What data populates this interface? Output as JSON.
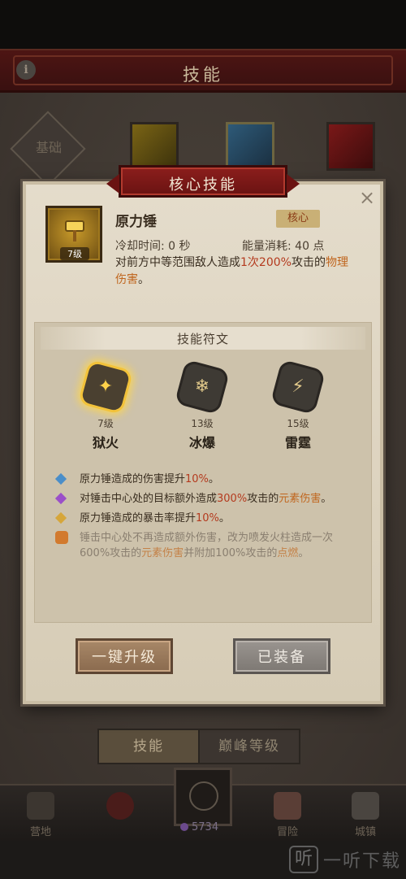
{
  "window": {
    "title": "技能"
  },
  "background": {
    "base_tab": "基础",
    "tabs": [
      {
        "label": "技能"
      },
      {
        "label": "巅峰等级"
      }
    ],
    "nav": [
      {
        "label": "营地"
      },
      {
        "label": ""
      },
      {
        "label": "冒险"
      },
      {
        "label": "城镇"
      }
    ],
    "currency": "5734"
  },
  "dialog": {
    "header": "核心技能",
    "close": "×",
    "skill": {
      "name": "原力锤",
      "level_tag": "7级",
      "badge": "核心",
      "cooldown": "冷却时间: 0 秒",
      "energy": "能量消耗: 40 点",
      "desc_prefix": "对前方中等范围敌人造成",
      "desc_count": "1次",
      "desc_percent": "200%",
      "desc_mid": "攻击的",
      "desc_type": "物理伤害",
      "desc_end": "。"
    },
    "runes": {
      "title": "技能符文",
      "items": [
        {
          "level": "7级",
          "name": "狱火"
        },
        {
          "level": "13级",
          "name": "冰爆"
        },
        {
          "level": "15级",
          "name": "雷霆"
        }
      ]
    },
    "effects": [
      {
        "a": "原力锤造成的伤害提升",
        "b": "10%",
        "c": "。",
        "color": "#4a8ec9"
      },
      {
        "a": "对锤击中心处的目标额外造成",
        "b": "300%",
        "c": "攻击的",
        "d": "元素伤害",
        "e": "。",
        "color": "#9b4fc9"
      },
      {
        "a": "原力锤造成的暴击率提升",
        "b": "10%",
        "c": "。",
        "color": "#d6a63a"
      },
      {
        "a": "锤击中心处不再造成额外伤害，改为喷发火柱造成一次600%攻击的",
        "b": "元素伤害",
        "c": "并附加100%攻击的",
        "d": "点燃",
        "e": "。"
      }
    ],
    "buttons": {
      "upgrade": "一键升级",
      "equipped": "已装备"
    }
  },
  "watermark": {
    "box": "听",
    "text": "一听下载"
  }
}
